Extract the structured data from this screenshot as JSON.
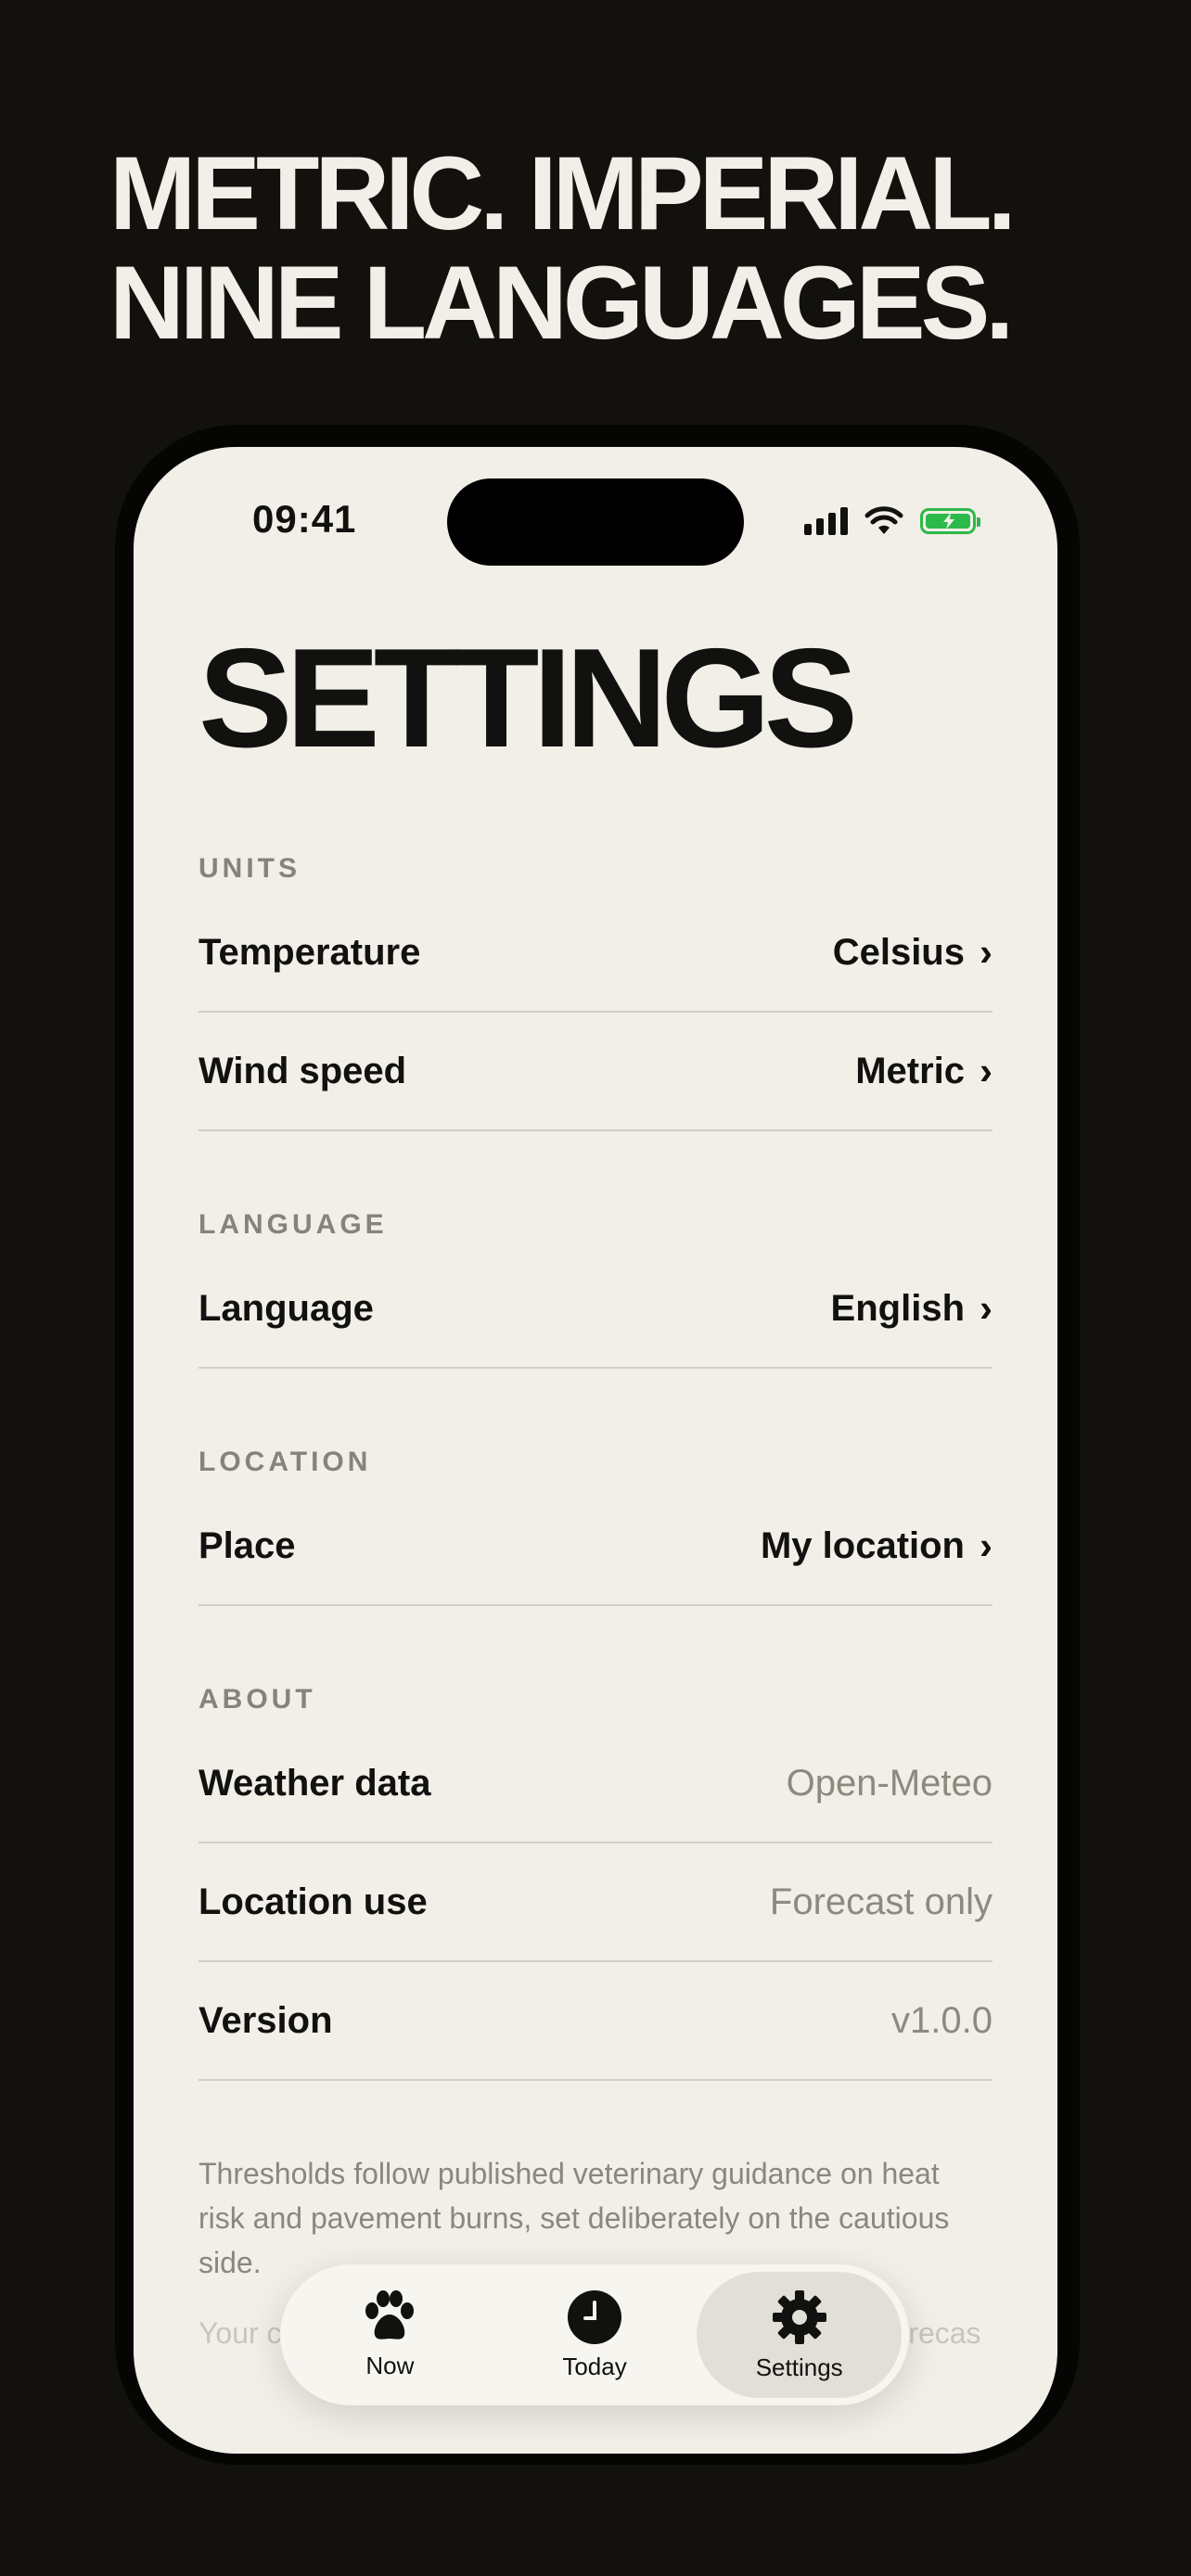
{
  "headline": {
    "line1": "METRIC. IMPERIAL.",
    "line2": "NINE LANGUAGES."
  },
  "status_bar": {
    "time": "09:41",
    "icons": [
      "signal-icon",
      "wifi-icon",
      "battery-charging-icon"
    ]
  },
  "screen_title": "SETTINGS",
  "sections": {
    "units": {
      "label": "UNITS",
      "rows": [
        {
          "label": "Temperature",
          "value": "Celsius"
        },
        {
          "label": "Wind speed",
          "value": "Metric"
        }
      ]
    },
    "language": {
      "label": "LANGUAGE",
      "rows": [
        {
          "label": "Language",
          "value": "English"
        }
      ]
    },
    "location": {
      "label": "LOCATION",
      "rows": [
        {
          "label": "Place",
          "value": "My location"
        }
      ]
    },
    "about": {
      "label": "ABOUT",
      "rows": [
        {
          "label": "Weather data",
          "value": "Open-Meteo"
        },
        {
          "label": "Location use",
          "value": "Forecast only"
        },
        {
          "label": "Version",
          "value": "v1.0.0"
        }
      ]
    }
  },
  "footnote": "Thresholds follow published veterinary guidance on heat risk and pavement burns, set deliberately on the cautious side.",
  "footnote_faded": "Your c                                                                    he forecas                                                                  collect anonymous usage data to improve the app —",
  "tab_bar": {
    "tabs": [
      {
        "label": "Now",
        "icon": "paw-icon"
      },
      {
        "label": "Today",
        "icon": "clock-icon"
      },
      {
        "label": "Settings",
        "icon": "gear-icon",
        "active": true
      }
    ]
  },
  "colors": {
    "page_bg": "#12110e",
    "screen_bg": "#f2efe8",
    "text": "#11110f",
    "muted": "#8d897f",
    "battery": "#2db84a"
  }
}
